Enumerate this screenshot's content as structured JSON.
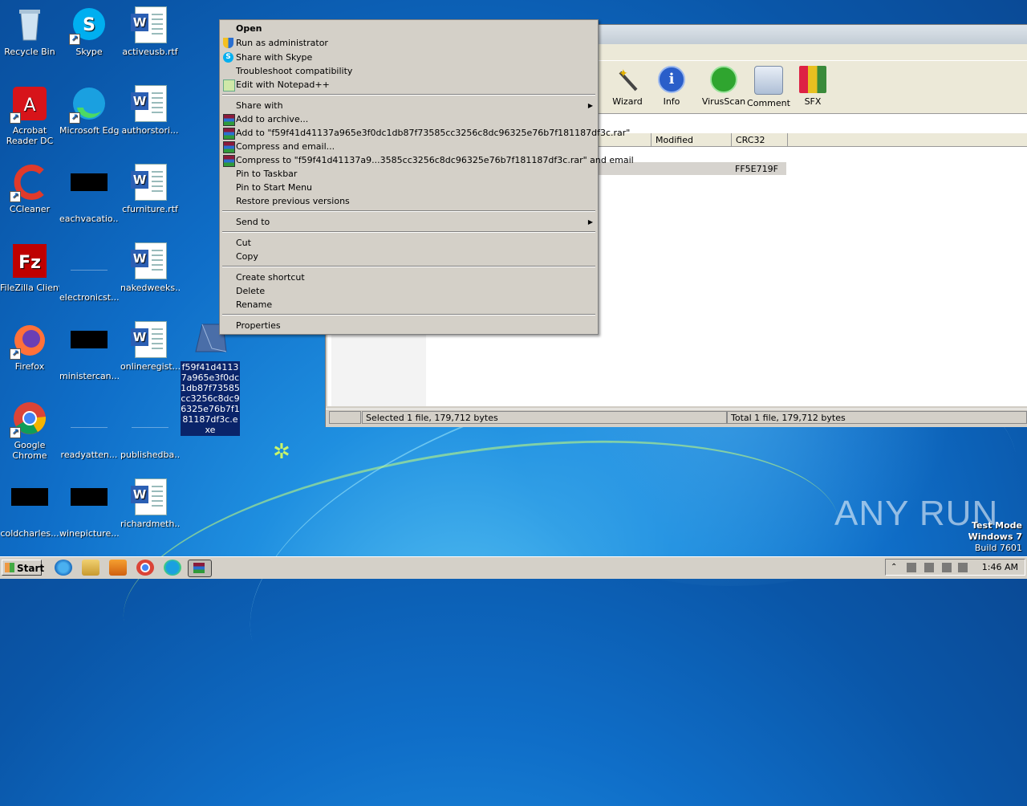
{
  "desktop": {
    "icons": [
      {
        "label": "Recycle Bin",
        "icon": "recycle-bin-icon"
      },
      {
        "label": "Skype",
        "icon": "skype-icon"
      },
      {
        "label": "activeusb.rtf",
        "icon": "word-doc-icon"
      },
      {
        "label": "Acrobat Reader DC",
        "icon": "acrobat-icon"
      },
      {
        "label": "Microsoft Edge",
        "icon": "edge-icon"
      },
      {
        "label": "authorstori...",
        "icon": "word-doc-icon"
      },
      {
        "label": "CCleaner",
        "icon": "ccleaner-icon"
      },
      {
        "label": "eachvacatio...",
        "icon": "black-file-icon"
      },
      {
        "label": "cfurniture.rtf",
        "icon": "word-doc-icon"
      },
      {
        "label": "FileZilla Client",
        "icon": "filezilla-icon"
      },
      {
        "label": "electronicst...",
        "icon": "blank-file-icon"
      },
      {
        "label": "nakedweeks...",
        "icon": "word-doc-icon"
      },
      {
        "label": "Firefox",
        "icon": "firefox-icon"
      },
      {
        "label": "ministercan...",
        "icon": "black-file-icon"
      },
      {
        "label": "onlineregist...",
        "icon": "word-doc-icon"
      },
      {
        "label": "Google Chrome",
        "icon": "chrome-icon"
      },
      {
        "label": "readyatten...",
        "icon": "blank-file-icon"
      },
      {
        "label": "publishedba...",
        "icon": "blank-file-icon"
      },
      {
        "label": "coldcharles...",
        "icon": "black-file-icon"
      },
      {
        "label": "winepicture...",
        "icon": "black-file-icon"
      },
      {
        "label": "richardmeth...",
        "icon": "word-doc-icon"
      }
    ],
    "selected_file": "f59f41d41137a965e3f0dc1db87f73585cc3256c8dc96325e76b7f181187df3c.exe"
  },
  "winrar": {
    "toolbar": [
      {
        "label": "Wizard",
        "icon": "wizard-icon"
      },
      {
        "label": "Info",
        "icon": "info-icon"
      },
      {
        "label": "VirusScan",
        "icon": "virusscan-icon"
      },
      {
        "label": "Comment",
        "icon": "comment-icon"
      },
      {
        "label": "SFX",
        "icon": "sfx-icon"
      }
    ],
    "columns": [
      "Modified",
      "CRC32"
    ],
    "row_crc": "FF5E719F",
    "status_left": "Selected 1 file, 179,712 bytes",
    "status_right": "Total 1 file, 179,712 bytes"
  },
  "context_menu": {
    "open": "Open",
    "run_as_admin": "Run as administrator",
    "share_skype": "Share with Skype",
    "troubleshoot": "Troubleshoot compatibility",
    "edit_npp": "Edit with Notepad++",
    "share_with": "Share with",
    "add_archive": "Add to archive...",
    "add_to_rar": "Add to \"f59f41d41137a965e3f0dc1db87f73585cc3256c8dc96325e76b7f181187df3c.rar\"",
    "compress_email": "Compress and email...",
    "compress_to_rar_email": "Compress to \"f59f41d41137a9...3585cc3256c8dc96325e76b7f181187df3c.rar\" and email",
    "pin_taskbar": "Pin to Taskbar",
    "pin_start": "Pin to Start Menu",
    "restore_versions": "Restore previous versions",
    "send_to": "Send to",
    "cut": "Cut",
    "copy": "Copy",
    "create_shortcut": "Create shortcut",
    "delete": "Delete",
    "rename": "Rename",
    "properties": "Properties"
  },
  "watermark": {
    "brand": "ANY RUN",
    "test_mode": "Test Mode",
    "os": "Windows 7",
    "build": "Build 7601"
  },
  "taskbar": {
    "start": "Start",
    "clock": "1:46 AM"
  }
}
